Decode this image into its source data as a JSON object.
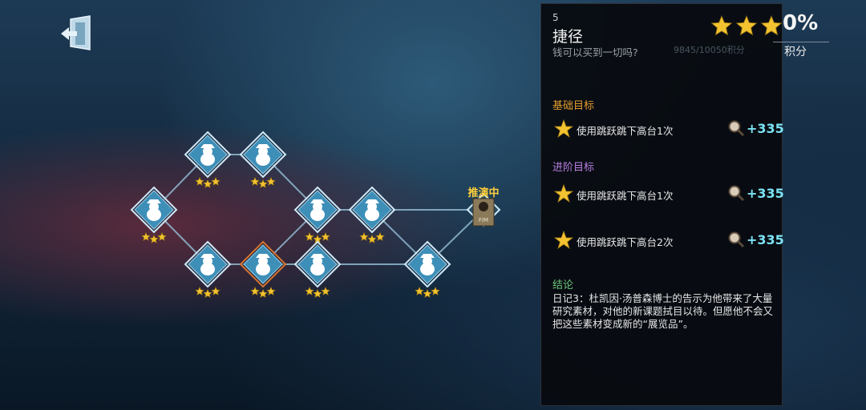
{
  "header": {
    "exit_icon": "exit-door-icon"
  },
  "map": {
    "current_label": "推演中",
    "current_badge": "FIM",
    "nodes": [
      {
        "id": "n1",
        "stars": 3,
        "state": "normal"
      },
      {
        "id": "n2",
        "stars": 3,
        "state": "normal"
      },
      {
        "id": "n3",
        "stars": 3,
        "state": "normal"
      },
      {
        "id": "n4",
        "stars": 3,
        "state": "normal"
      },
      {
        "id": "n5",
        "stars": 3,
        "state": "normal"
      },
      {
        "id": "n6",
        "stars": 3,
        "state": "selected"
      },
      {
        "id": "n7",
        "stars": 3,
        "state": "normal"
      },
      {
        "id": "n8",
        "stars": 3,
        "state": "normal"
      },
      {
        "id": "n9",
        "stars": 3,
        "state": "normal"
      },
      {
        "id": "n10",
        "stars": 0,
        "state": "current"
      }
    ]
  },
  "panel": {
    "number": "5",
    "title": "捷径",
    "subtitle": "钱可以买到一切吗?",
    "rating_stars": 3,
    "percent_text": "0%",
    "score_text": "积分",
    "coin_text": "9845/10050积分",
    "basic": {
      "heading": "基础目标",
      "goals": [
        {
          "text": "使用跳跃跳下高台1次",
          "reward": "+335"
        }
      ]
    },
    "advanced": {
      "heading": "进阶目标",
      "goals": [
        {
          "text": "使用跳跃跳下高台1次",
          "reward": "+335"
        },
        {
          "text": "使用跳跃跳下高台2次",
          "reward": "+335"
        }
      ]
    },
    "conclusion": {
      "heading": "结论",
      "text": "日记3：杜凯因·汤普森博士的告示为他带来了大量研究素材，对他的新课题拭目以待。但愿他不会又把这些素材变成新的“展览品”。"
    }
  },
  "colors": {
    "node_fill": "#3d8fb8",
    "node_border": "#cfe9f7",
    "selected_border": "#d7722e",
    "star": "#f2c230",
    "reward": "#7be3f5"
  }
}
